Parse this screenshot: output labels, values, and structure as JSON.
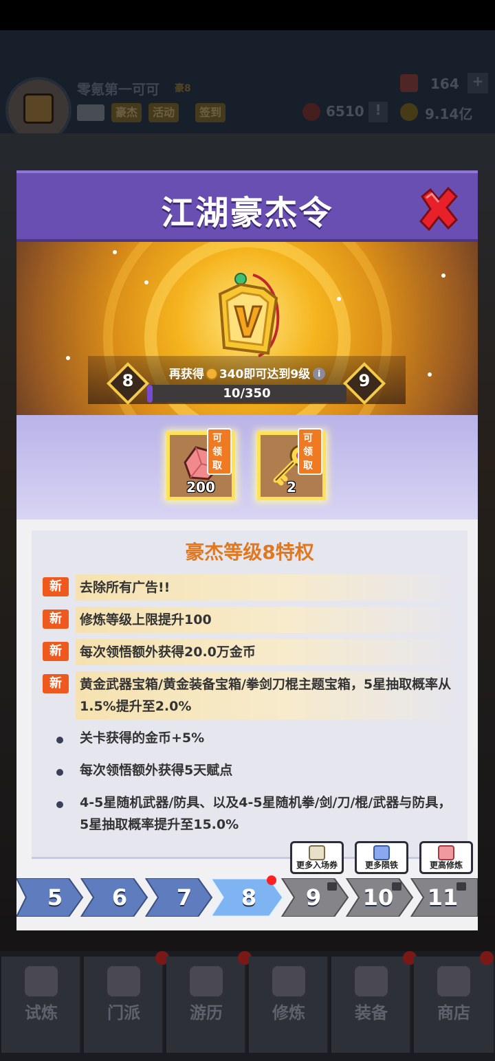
{
  "colors": {
    "modal_header": "#6a4fb3",
    "accent_orange": "#ee5a1e",
    "gold": "#ffe25a",
    "tab_active": "#5b8cd8",
    "tab_locked": "#8a8a8e"
  },
  "background_header": {
    "player_name": "零氪第一可可",
    "player_rank": "豪8",
    "buttons": [
      "豪杰",
      "活动",
      "签到"
    ],
    "gems": "164",
    "tokens": "6510",
    "gold": "9.14亿",
    "plus": "+",
    "alert": "!"
  },
  "modal": {
    "title": "江湖豪杰令",
    "current_level": "8",
    "next_level": "9",
    "progress_prefix": "再获得",
    "progress_amount": "340即可达到9级",
    "progress_info": "i",
    "progress_value": "10/350",
    "progress_fraction": 0.0286,
    "rewards": [
      {
        "icon": "crystal-icon",
        "count": "200",
        "tag": "可领取"
      },
      {
        "icon": "key-icon",
        "count": "2",
        "tag": "可领取"
      }
    ],
    "perks_title": "豪杰等级8特权",
    "new_badge": "新",
    "new_perks": [
      "去除所有广告!!",
      "修炼等级上限提升100",
      "每次领悟额外获得20.0万金币",
      "黄金武器宝箱/黄金装备宝箱/拳剑刀棍主题宝箱，5星抽取概率从1.5%提升至2.0%"
    ],
    "perks": [
      "关卡获得的金币+5%",
      "每次领悟额外获得5天赋点",
      "4-5星随机武器/防具、以及4-5星随机拳/剑/刀/棍/武器与防具，5星抽取概率提升至15.0%"
    ],
    "tooltips": [
      {
        "label": "更多入场券",
        "icon": "ticket-icon"
      },
      {
        "label": "更多陨铁",
        "icon": "meteor-iron-icon"
      },
      {
        "label": "更高修炼",
        "icon": "training-icon"
      }
    ],
    "level_tabs": [
      {
        "label": "5",
        "state": "past"
      },
      {
        "label": "6",
        "state": "past"
      },
      {
        "label": "7",
        "state": "past"
      },
      {
        "label": "8",
        "state": "current"
      },
      {
        "label": "9",
        "state": "locked"
      },
      {
        "label": "10",
        "state": "locked"
      },
      {
        "label": "11",
        "state": "locked"
      }
    ]
  },
  "bottom_nav": [
    "试炼",
    "门派",
    "游历",
    "修炼",
    "装备",
    "商店"
  ]
}
